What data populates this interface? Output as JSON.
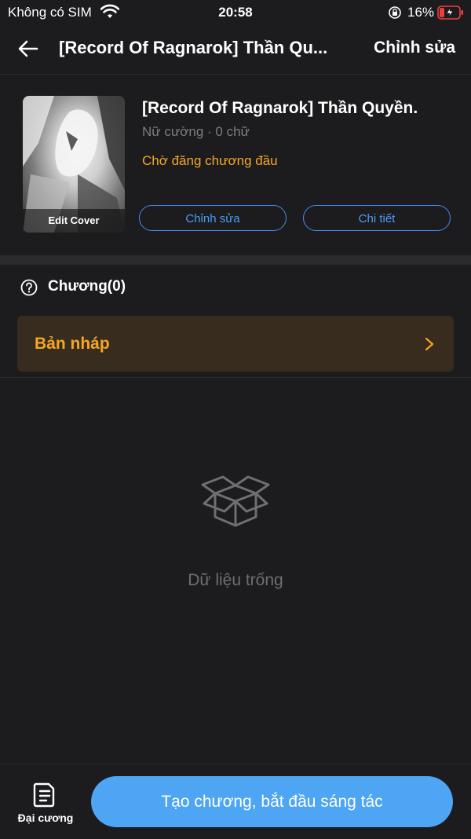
{
  "status_bar": {
    "carrier": "Không có SIM",
    "time": "20:58",
    "battery": "16%"
  },
  "nav": {
    "title": "[Record Of Ragnarok] Thần Qu...",
    "edit_label": "Chỉnh sửa"
  },
  "book": {
    "title": "[Record Of Ragnarok] Thần Quyền.",
    "meta": "Nữ cường · 0 chữ",
    "status": "Chờ đăng chương đầu",
    "cover_label": "Edit Cover",
    "edit_button": "Chỉnh sửa",
    "detail_button": "Chi tiết"
  },
  "chapters": {
    "label": "Chương(0)",
    "draft_label": "Bản nháp",
    "empty_text": "Dữ liệu trống"
  },
  "bottom": {
    "outline_label": "Đại cương",
    "create_label": "Tạo chương, bắt đầu sáng tác"
  },
  "colors": {
    "accent": "#4ea5f4",
    "orange": "#f5a623",
    "background": "#1c1c1e"
  }
}
